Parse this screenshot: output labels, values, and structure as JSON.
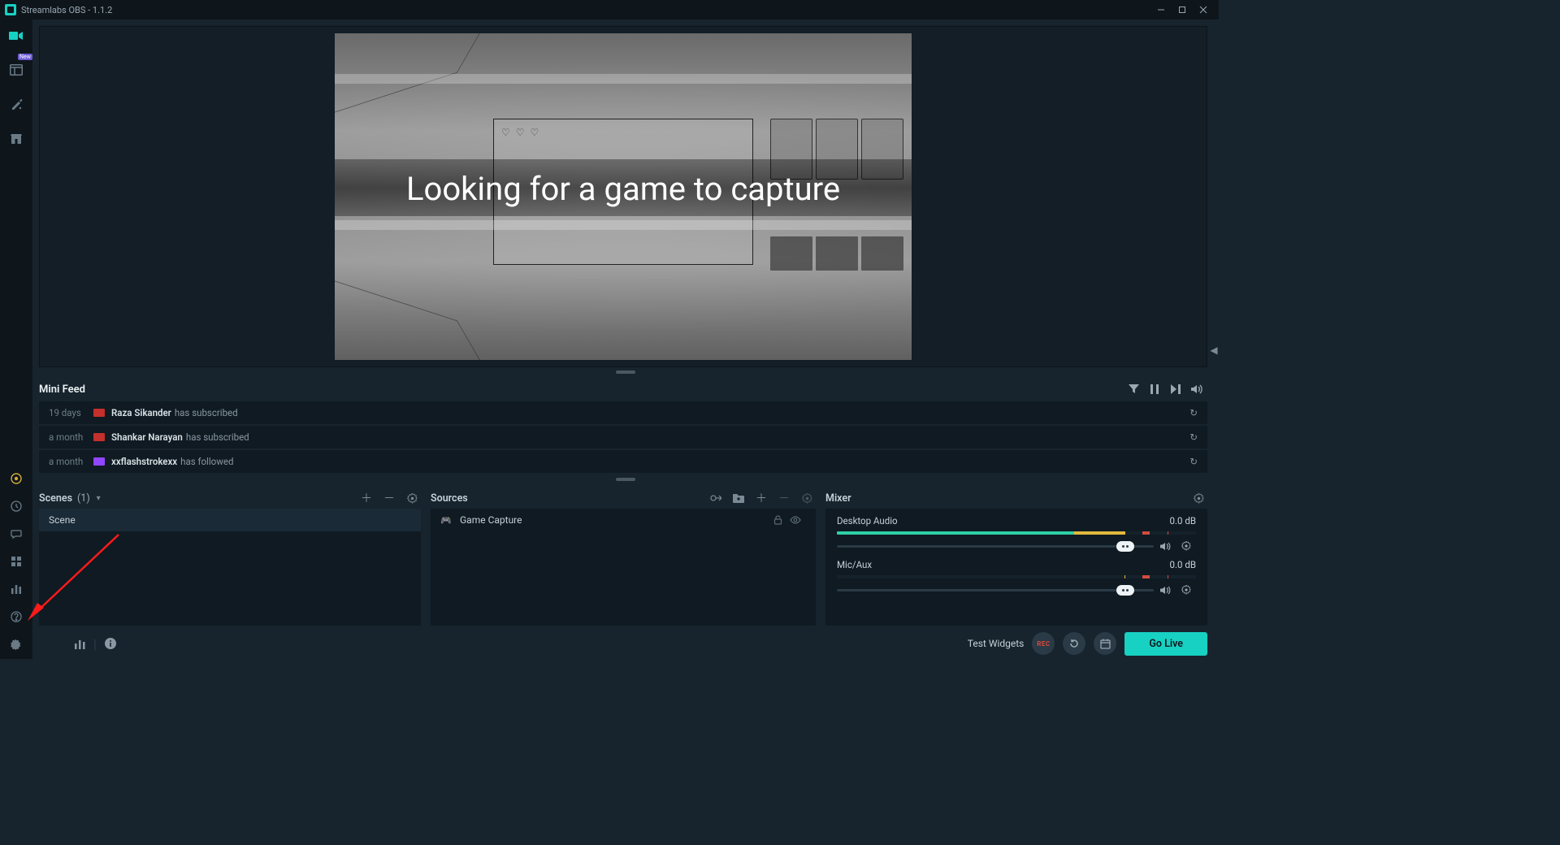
{
  "window": {
    "title": "Streamlabs OBS - 1.1.2"
  },
  "sidebar": {
    "badge_new": "New"
  },
  "preview": {
    "overlay_text": "Looking for a game to capture",
    "hearts": "♡ ♡ ♡"
  },
  "feed": {
    "title": "Mini Feed",
    "items": [
      {
        "time": "19 days",
        "platform": "yt",
        "user": "Raza Sikander",
        "action": "has subscribed"
      },
      {
        "time": "a month",
        "platform": "yt",
        "user": "Shankar Narayan",
        "action": "has subscribed"
      },
      {
        "time": "a month",
        "platform": "tw",
        "user": "xxflashstrokexx",
        "action": "has followed"
      }
    ]
  },
  "scenes": {
    "title": "Scenes",
    "count": "(1)",
    "items": [
      {
        "name": "Scene"
      }
    ]
  },
  "sources": {
    "title": "Sources",
    "items": [
      {
        "name": "Game Capture"
      }
    ]
  },
  "mixer": {
    "title": "Mixer",
    "items": [
      {
        "name": "Desktop Audio",
        "level": "0.0 dB"
      },
      {
        "name": "Mic/Aux",
        "level": "0.0 dB"
      }
    ]
  },
  "footer": {
    "test_widgets": "Test Widgets",
    "rec": "REC",
    "go_live": "Go Live"
  }
}
